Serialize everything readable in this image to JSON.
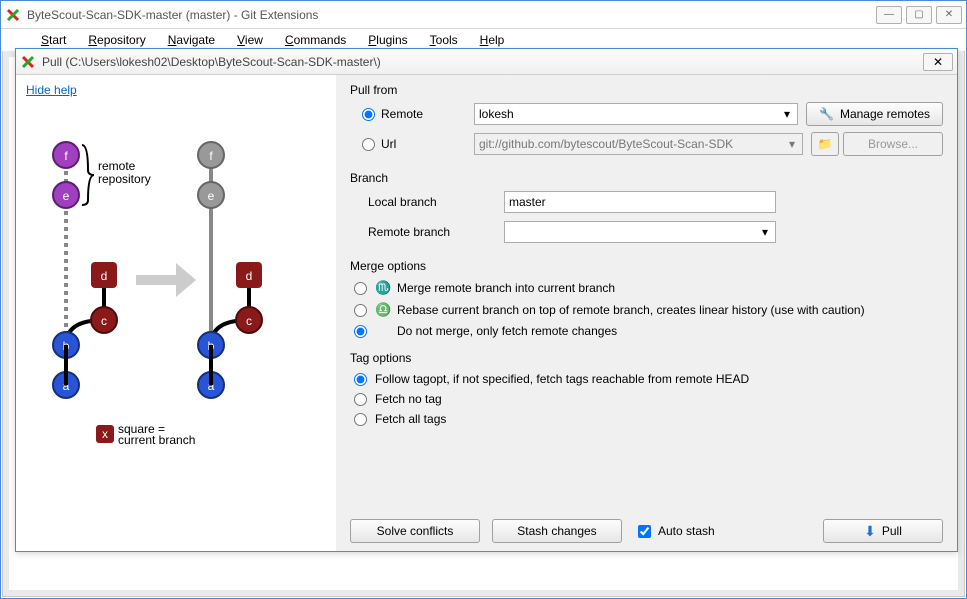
{
  "main": {
    "title": "ByteScout-Scan-SDK-master (master) - Git Extensions",
    "menus": [
      "Start",
      "Repository",
      "Navigate",
      "View",
      "Commands",
      "Plugins",
      "Tools",
      "Help"
    ]
  },
  "dialog": {
    "title": "Pull (C:\\Users\\lokesh02\\Desktop\\ByteScout-Scan-SDK-master\\)",
    "hide_help": "Hide help",
    "pull_from": {
      "label": "Pull from",
      "remote_label": "Remote",
      "url_label": "Url",
      "remote_value": "lokesh",
      "url_value": "git://github.com/bytescout/ByteScout-Scan-SDK",
      "manage_remotes": "Manage remotes",
      "browse": "Browse...",
      "selected": "remote"
    },
    "branch": {
      "label": "Branch",
      "local_label": "Local branch",
      "remote_label": "Remote branch",
      "local_value": "master",
      "remote_value": ""
    },
    "merge": {
      "label": "Merge options",
      "opt_merge": "Merge remote branch into current branch",
      "opt_rebase": "Rebase current branch on top of remote branch, creates linear history (use with caution)",
      "opt_fetch": "Do not merge, only fetch remote changes",
      "selected": "fetch"
    },
    "tags": {
      "label": "Tag options",
      "opt_follow": "Follow tagopt, if not specified, fetch tags reachable from remote HEAD",
      "opt_none": "Fetch no tag",
      "opt_all": "Fetch all tags",
      "selected": "follow"
    },
    "buttons": {
      "solve": "Solve conflicts",
      "stash": "Stash changes",
      "autostash": "Auto stash",
      "pull": "Pull"
    },
    "diagram": {
      "remote_repo_label": "remote\nrepository",
      "legend": "square =\ncurrent branch"
    }
  }
}
